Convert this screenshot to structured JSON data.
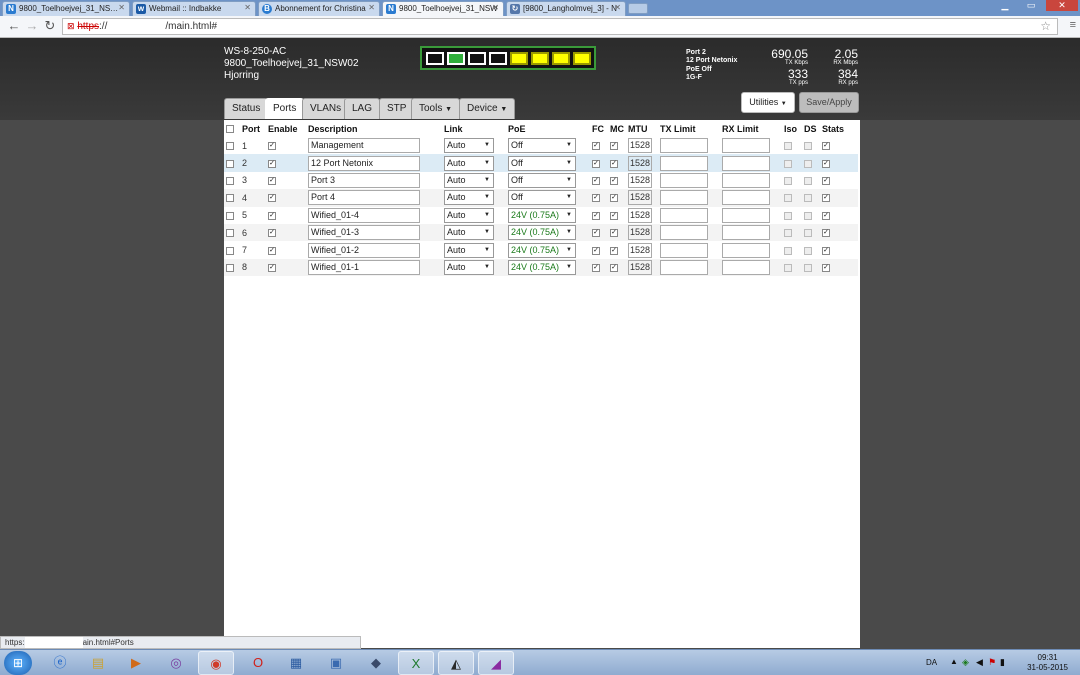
{
  "browser": {
    "tabs": [
      {
        "title": "9800_Toelhoejvej_31_NS…",
        "icon": "N"
      },
      {
        "title": "Webmail :: Indbakke",
        "icon": "w"
      },
      {
        "title": "Abonnement for Christina",
        "icon": "B"
      },
      {
        "title": "9800_Toelhoejvej_31_NSW",
        "icon": "N"
      },
      {
        "title": "[9800_Langholmvej_3] - N",
        "icon": "↻"
      }
    ],
    "url_scheme": "https",
    "url_sep": "://",
    "url_path": "/main.html#",
    "status_prefix": "https:",
    "status_suffix": "ain.html#Ports"
  },
  "device": {
    "model": "WS-8-250-AC",
    "name": "9800_Toelhoejvej_31_NSW02",
    "location": "Hjorring"
  },
  "port_status": {
    "lines": [
      "Port 2",
      "12 Port Netonix",
      "PoE Off",
      "1G-F"
    ],
    "tx_kbps": "690.05",
    "tx_kbps_label": "TX Kbps",
    "rx_mbps": "2.05",
    "rx_mbps_label": "RX Mbps",
    "tx_pps": "333",
    "tx_pps_label": "TX pps",
    "rx_pps": "384",
    "rx_pps_label": "RX pps"
  },
  "tabs": [
    "Status",
    "Ports",
    "VLANs",
    "LAG",
    "STP",
    "Tools",
    "Device"
  ],
  "utilities_label": "Utilities",
  "save_label": "Save/Apply",
  "table": {
    "headers": [
      "Port",
      "Enable",
      "Description",
      "Link",
      "PoE",
      "FC",
      "MC",
      "MTU",
      "TX Limit",
      "RX Limit",
      "Iso",
      "DS",
      "Stats"
    ],
    "rows": [
      {
        "port": "1",
        "desc": "Management",
        "link": "Auto",
        "poe": "Off",
        "mtu": "1528"
      },
      {
        "port": "2",
        "desc": "12 Port Netonix",
        "link": "Auto",
        "poe": "Off",
        "mtu": "1528"
      },
      {
        "port": "3",
        "desc": "Port 3",
        "link": "Auto",
        "poe": "Off",
        "mtu": "1528"
      },
      {
        "port": "4",
        "desc": "Port 4",
        "link": "Auto",
        "poe": "Off",
        "mtu": "1528"
      },
      {
        "port": "5",
        "desc": "Wified_01-4",
        "link": "Auto",
        "poe": "24V (0.75A)",
        "mtu": "1528"
      },
      {
        "port": "6",
        "desc": "Wified_01-3",
        "link": "Auto",
        "poe": "24V (0.75A)",
        "mtu": "1528"
      },
      {
        "port": "7",
        "desc": "Wified_01-2",
        "link": "Auto",
        "poe": "24V (0.75A)",
        "mtu": "1528"
      },
      {
        "port": "8",
        "desc": "Wified_01-1",
        "link": "Auto",
        "poe": "24V (0.75A)",
        "mtu": "1528"
      }
    ]
  },
  "tray": {
    "lang": "DA",
    "time": "09:31",
    "date": "31-05-2015"
  },
  "colors": {
    "poe_green": "#1a7a1a",
    "port_active": "#2fae3a",
    "port_poe": "#ffff00"
  }
}
